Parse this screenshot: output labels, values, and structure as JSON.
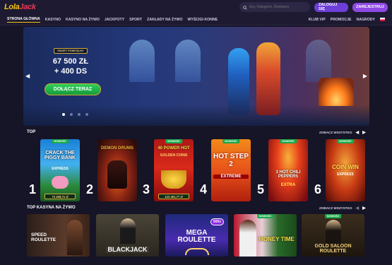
{
  "logo": {
    "part1": "Lola",
    "part2": "Jack"
  },
  "search": {
    "placeholder": "Gry, Kategorie, Dostawcy"
  },
  "auth": {
    "login_label": "ZALOGUJ SIĘ",
    "register_label": "ZAREJESTRUJ"
  },
  "nav": {
    "items": [
      "STRONA GŁÓWNA",
      "KASYNO",
      "KASYNO NA ŻYWO",
      "JACKPOTY",
      "SPORT",
      "ZAKŁADY NA ŻYWO",
      "WYŚCIGI KONNE"
    ],
    "right_items": [
      "KLUB VIP",
      "PROMOCJE",
      "NAGRODY"
    ]
  },
  "hero": {
    "tag": "PAKIET POWITALNY",
    "amount": "67 500 ZŁ",
    "bonus": "+ 400 DS",
    "cta_label": "DOŁĄCZ TERAZ",
    "slides_total": 4,
    "active_slide": 1
  },
  "top_section": {
    "title": "TOP",
    "see_all": "ZOBACZ WSZYSTKO"
  },
  "top_games": [
    {
      "rank": "1",
      "badge": "NOWOŚĆ",
      "title": "CRACK THE PIGGY BANK",
      "sub": "EXPRESS",
      "jackpot": "73 498,71 zł"
    },
    {
      "rank": "2",
      "badge": "",
      "title": "DEMON DRUMS",
      "sub": "",
      "jackpot": ""
    },
    {
      "rank": "3",
      "badge": "NOWOŚĆ",
      "title": "40 POWER HOT",
      "sub": "GOLDEN COINS",
      "jackpot": "123 491,77 zł"
    },
    {
      "rank": "4",
      "badge": "NOWOŚĆ",
      "title": "HOT STEP 2",
      "sub": "EXTREME",
      "jackpot": ""
    },
    {
      "rank": "5",
      "badge": "NOWOŚĆ",
      "title": "3 HOT CHILI PEPPERS",
      "sub": "EXTRA",
      "jackpot": ""
    },
    {
      "rank": "6",
      "badge": "NOWOŚĆ",
      "title": "COIN WIN",
      "sub": "EXPRESS",
      "jackpot": ""
    }
  ],
  "live_section": {
    "title": "TOP KASYNA NA ŻYWO",
    "see_all": "ZOBACZ WSZYSTKO"
  },
  "live_games": [
    {
      "badge": "",
      "title": "SPEED ROULETTE",
      "extra": ""
    },
    {
      "badge": "",
      "title": "BLACKJACK",
      "extra": ""
    },
    {
      "badge": "",
      "title": "MEGA ROULETTE",
      "extra": "500x"
    },
    {
      "badge": "NOWOŚĆ",
      "title": "MONEY TIME",
      "extra": ""
    },
    {
      "badge": "NOWOŚĆ",
      "title": "GOLD SALOON ROULETTE",
      "extra": ""
    }
  ],
  "colors": {
    "bg": "#161427",
    "accent_purple": "#6d3fd8",
    "cta_green": "#1fb84a",
    "gold": "#d4af37",
    "new_badge": "#1aa84a"
  }
}
